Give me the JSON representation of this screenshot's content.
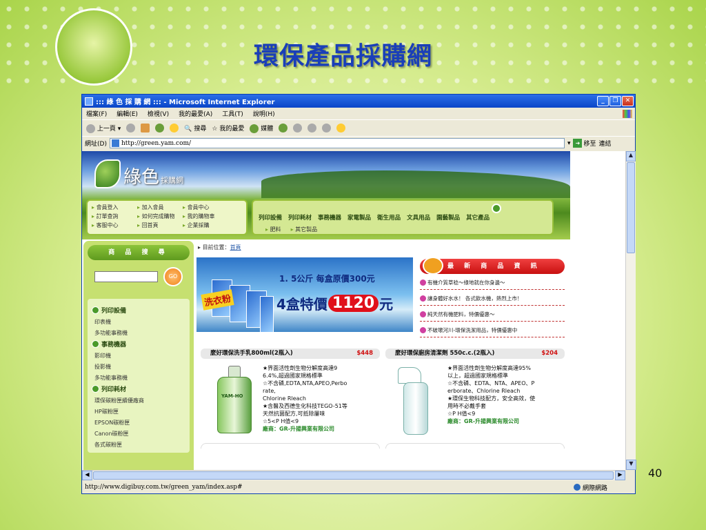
{
  "slide": {
    "title": "環保產品採購網",
    "page_number": "40"
  },
  "window": {
    "title": "::: 綠 色 採 購 網 ::: - Microsoft Internet Explorer",
    "buttons": [
      "_",
      "❐",
      "✕"
    ]
  },
  "menu": [
    "檔案(F)",
    "編輯(E)",
    "檢視(V)",
    "我的最愛(A)",
    "工具(T)",
    "說明(H)"
  ],
  "toolbar": {
    "back": "上一頁",
    "search": "搜尋",
    "favorites": "我的最愛",
    "media": "媒體"
  },
  "address": {
    "label": "網址(D)",
    "url": "http://green.yam.com/",
    "go": "移至",
    "links": "連結"
  },
  "status": {
    "url": "http://www.digibuy.com.tw/green_yam/index.asp#",
    "zone": "網際網路"
  },
  "site": {
    "logo_big": "綠色",
    "logo_small": "採購網",
    "member_links": [
      "會員登入",
      "加入會員",
      "會員中心",
      "訂單查詢",
      "如何完成購物",
      "我的購物車",
      "客服中心",
      "回首頁",
      "企業採購"
    ],
    "nav_main": [
      "列印設備",
      "列印耗材",
      "事務機器",
      "家電製品",
      "衛生用品",
      "文具用品",
      "園藝製品",
      "其它產品"
    ],
    "nav_sub": [
      "肥料",
      "其它製品"
    ],
    "search_head": "商 品 搜 尋",
    "search_go": "GO",
    "categories": [
      {
        "head": "列印設備",
        "items": [
          "印表機",
          "多功能事務機"
        ]
      },
      {
        "head": "事務機器",
        "items": [
          "影印機",
          "投影機",
          "多功能事務機"
        ]
      },
      {
        "head": "列印耗材",
        "items": [
          "環保碳粉匣續優廠商",
          "HP碳粉匣",
          "EPSON碳粉匣",
          "Canon碳粉匣",
          "各式碳粉匣"
        ]
      }
    ],
    "breadcrumb_label": "目前位置：",
    "breadcrumb_home": "首頁",
    "banner": {
      "line1": "1. 5公斤 每盒原價300元",
      "line2_pre": "4盒特價",
      "price": "1120",
      "line2_post": "元",
      "tag": "洗衣粉"
    },
    "news_head": "最 新 商 品 資 訊",
    "news": [
      "有機介質草稔～綠地就在你身邊～",
      "讓身體好水水！ 各式飲水機，熱烈上市！",
      "純天然有機肥料，特價優惠～",
      "不破壞河川-環保洗潔用品，特價優惠中"
    ],
    "products": [
      {
        "title": "麼好環保洗手乳800ml(2瓶入)",
        "price": "$448",
        "desc": "★界面活性劑生物分解度高達9\n6.4%,超過國家規格標準\n☆不含磷,EDTA,NTA,APEO,Perbo\nrate,\nChlorine Rleach\n★含醫及西德生化科技TEGO-51等\n天然抗菌配方,可抵除屢味\n☆5<P H值<9",
        "vendor": "廠商：GR-升揚興業有限公司",
        "brand": "YAM-HO"
      },
      {
        "title": "麼好環保廚房清潔劑 550c.c.(2瓶入)",
        "price": "$204",
        "desc": "★界面活性劑生物分解度高達95%\n以上，超過國家規格標準\n☆不含磷、EDTA、NTA、APEO、P\nerborate、Chlorine Rleach\n★環保生物科技配方，安全高效，使\n用時不必戴手套\n☆P H值<9",
        "vendor": "廠商：GR-升揚興業有限公司"
      }
    ]
  },
  "colors": {
    "title_blue": "#1a3fb8",
    "price_red": "#d01010",
    "vendor_green": "#2a8a2a"
  }
}
